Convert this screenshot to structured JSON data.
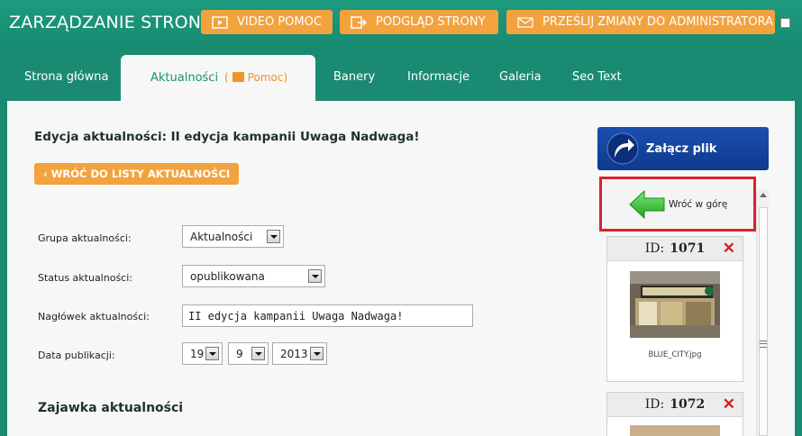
{
  "header": {
    "brand": "ZARZĄDZANIE STRONĄ",
    "video_help": "VIDEO POMOC",
    "preview": "PODGLĄD STRONY",
    "send_changes": "PRZEŚLIJ ZMIANY DO ADMINISTRATORA",
    "accent_color": "#f3a23e",
    "background_color": "#1a8a72"
  },
  "tabs": [
    {
      "label": "Strona główna"
    },
    {
      "label": "Aktualności",
      "help": "Pomoc",
      "active": true
    },
    {
      "label": "Banery"
    },
    {
      "label": "Informacje"
    },
    {
      "label": "Galeria"
    },
    {
      "label": "Seo Text"
    }
  ],
  "main": {
    "title": "Edycja aktualności: II edycja kampanii Uwaga Nadwaga!",
    "back_button": "‹ WRÓĆ DO LISTY AKTUALNOŚCI",
    "form": {
      "group_label": "Grupa aktualności:",
      "group_value": "Aktualności",
      "status_label": "Status aktualności:",
      "status_value": "opublikowana",
      "headline_label": "Nagłówek aktualności:",
      "headline_value": "II edycja kampanii Uwaga Nadwaga!",
      "date_label": "Data publikacji:",
      "day": "19",
      "month": "9",
      "year": "2013"
    },
    "teaser_heading": "Zajawka aktualności"
  },
  "sidebar": {
    "attach_label": "Załącz plik",
    "back_to_top": "Wróć w górę",
    "highlight_color": "#d8232a",
    "files": [
      {
        "id_label": "ID:",
        "id": "1071",
        "filename": "BLUE_CITY.jpg"
      },
      {
        "id_label": "ID:",
        "id": "1072",
        "filename": ""
      }
    ]
  }
}
